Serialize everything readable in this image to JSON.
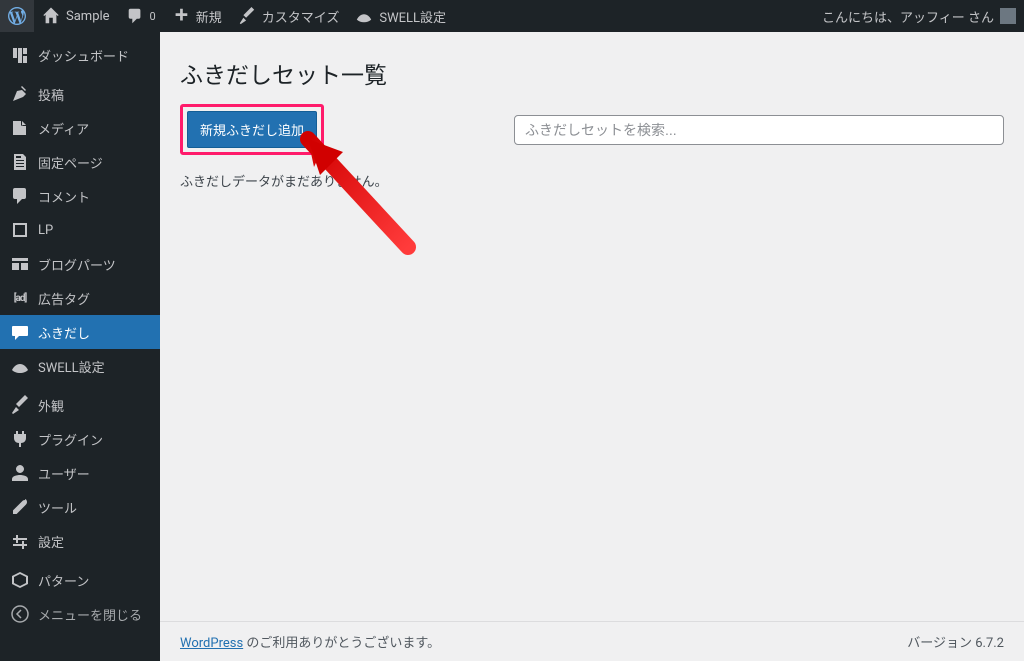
{
  "adminbar": {
    "site_name": "Sample",
    "comments_count": "0",
    "new_label": "新規",
    "customize_label": "カスタマイズ",
    "swell_label": "SWELL設定",
    "greeting": "こんにちは、アッフィー さん"
  },
  "sidebar": {
    "items": [
      {
        "label": "ダッシュボード",
        "icon": "dashboard"
      },
      {
        "label": "投稿",
        "icon": "pin"
      },
      {
        "label": "メディア",
        "icon": "media"
      },
      {
        "label": "固定ページ",
        "icon": "page"
      },
      {
        "label": "コメント",
        "icon": "comment"
      },
      {
        "label": "LP",
        "icon": "lp"
      },
      {
        "label": "ブログパーツ",
        "icon": "blogparts"
      },
      {
        "label": "広告タグ",
        "icon": "adtag"
      },
      {
        "label": "ふきだし",
        "icon": "balloon",
        "current": true
      },
      {
        "label": "SWELL設定",
        "icon": "swell"
      },
      {
        "label": "外観",
        "icon": "appearance"
      },
      {
        "label": "プラグイン",
        "icon": "plugin"
      },
      {
        "label": "ユーザー",
        "icon": "user"
      },
      {
        "label": "ツール",
        "icon": "tool"
      },
      {
        "label": "設定",
        "icon": "settings"
      },
      {
        "label": "パターン",
        "icon": "pattern"
      }
    ],
    "collapse_label": "メニューを閉じる"
  },
  "page": {
    "title": "ふきだしセット一覧",
    "add_new_label": "新規ふきだし追加",
    "search_placeholder": "ふきだしセットを検索...",
    "empty_message": "ふきだしデータがまだありません。"
  },
  "footer": {
    "wp_link": "WordPress",
    "thanks_text": " のご利用ありがとうございます。",
    "version": "バージョン 6.7.2"
  },
  "colors": {
    "accent": "#2271b1",
    "highlight": "#ff1b6b",
    "arrow": "#d10000"
  }
}
